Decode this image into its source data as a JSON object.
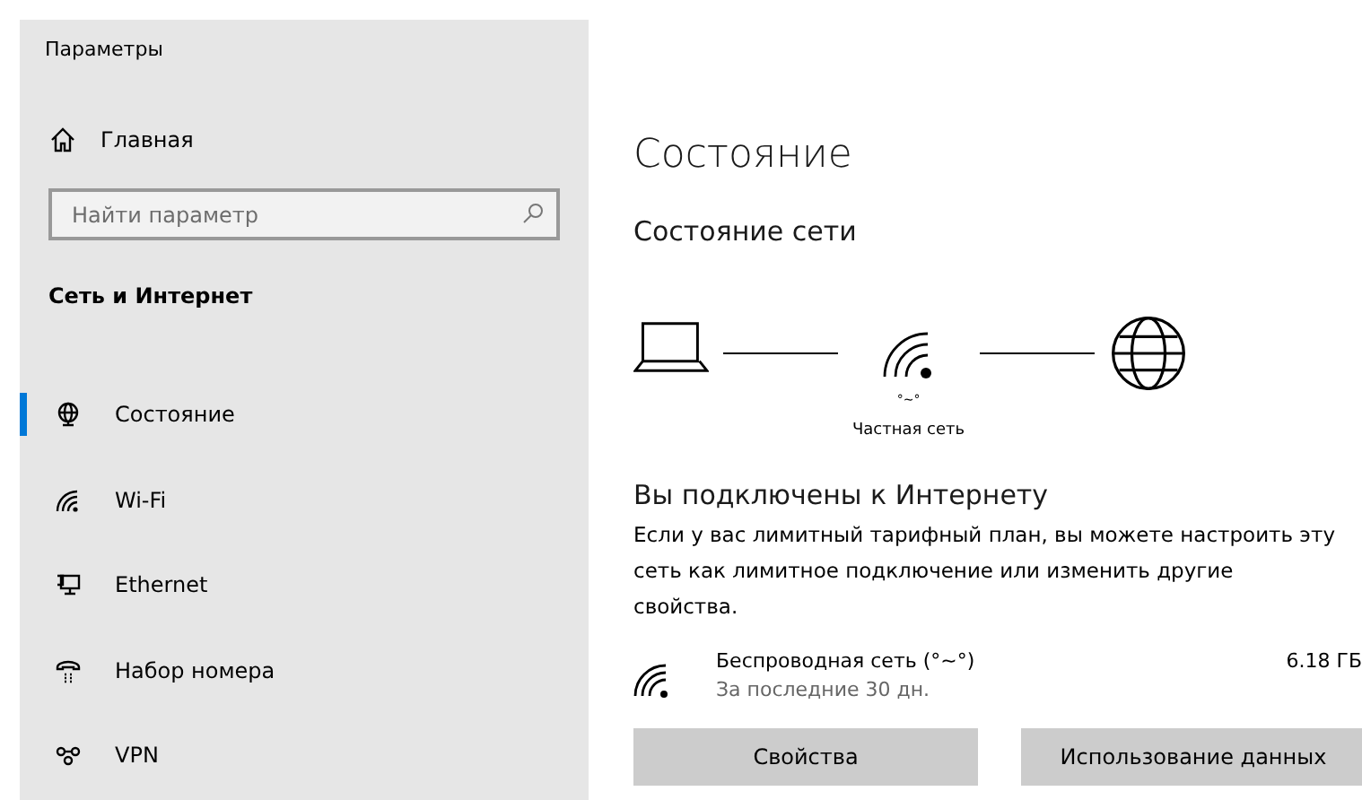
{
  "window": {
    "title": "Параметры"
  },
  "sidebar": {
    "home": "Главная",
    "search": {
      "placeholder": "Найти параметр"
    },
    "section": "Сеть и Интернет",
    "items": [
      {
        "label": "Состояние",
        "selected": true
      },
      {
        "label": "Wi-Fi",
        "selected": false
      },
      {
        "label": "Ethernet",
        "selected": false
      },
      {
        "label": "Набор номера",
        "selected": false
      },
      {
        "label": "VPN",
        "selected": false
      }
    ]
  },
  "main": {
    "title": "Состояние",
    "subtitle": "Состояние сети",
    "diagram": {
      "network_name": "°~°",
      "network_type": "Частная сеть"
    },
    "connected_title": "Вы подключены к Интернету",
    "description": "Если у вас лимитный тарифный план, вы можете настроить эту сеть как лимитное подключение или изменить другие свойства.",
    "connection": {
      "name": "Беспроводная сеть (°~°)",
      "period": "За последние 30 дн.",
      "usage": "6.18 ГБ"
    },
    "buttons": [
      "Свойства",
      "Использование данных"
    ]
  }
}
